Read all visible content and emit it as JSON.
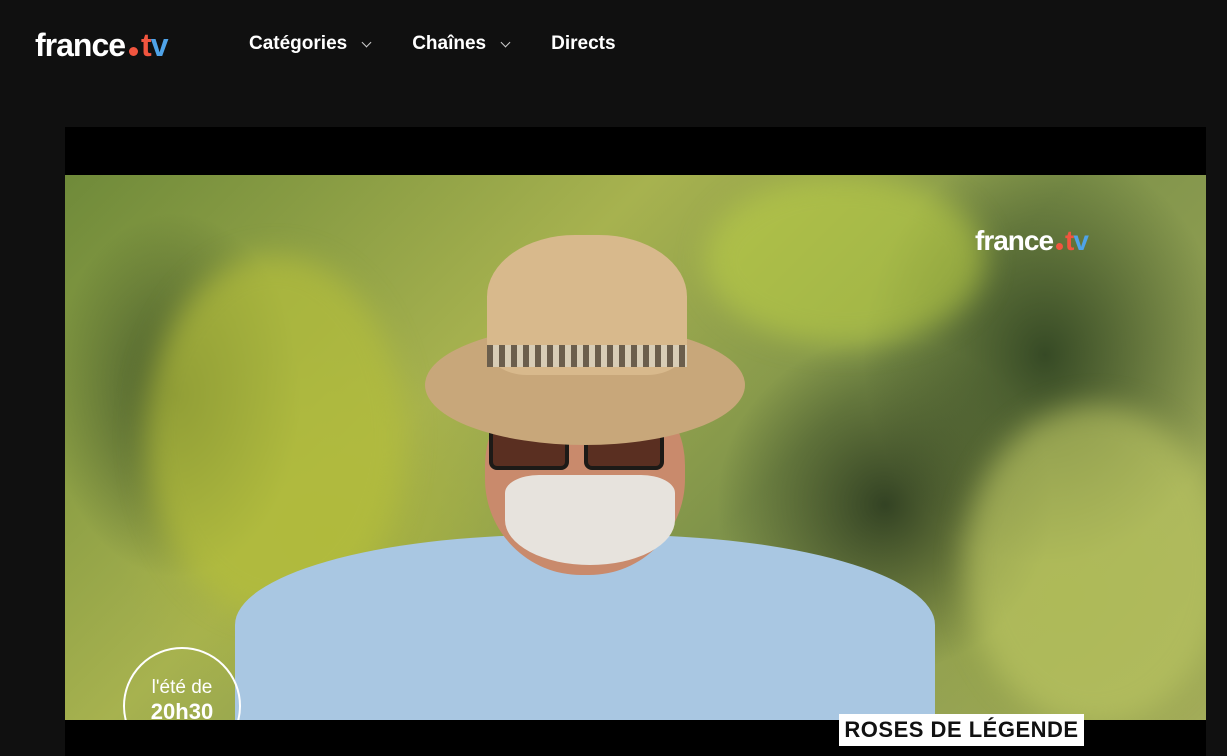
{
  "header": {
    "logo": {
      "word": "france",
      "tv_t": "t",
      "tv_v": "v"
    },
    "nav": [
      {
        "label": "Catégories",
        "has_dropdown": true
      },
      {
        "label": "Chaînes",
        "has_dropdown": true
      },
      {
        "label": "Directs",
        "has_dropdown": false
      }
    ]
  },
  "player": {
    "channel_logo": {
      "word": "france",
      "tv_t": "t",
      "tv_v": "v"
    },
    "program_badge": {
      "line1": "l'été de",
      "line2": "20h30"
    },
    "caption": "ROSES DE LÉGENDE"
  },
  "colors": {
    "background": "#101010",
    "accent_red": "#f1553f",
    "accent_blue": "#4fa3e8"
  },
  "icons": {
    "dropdown": "chevron-down-icon"
  }
}
